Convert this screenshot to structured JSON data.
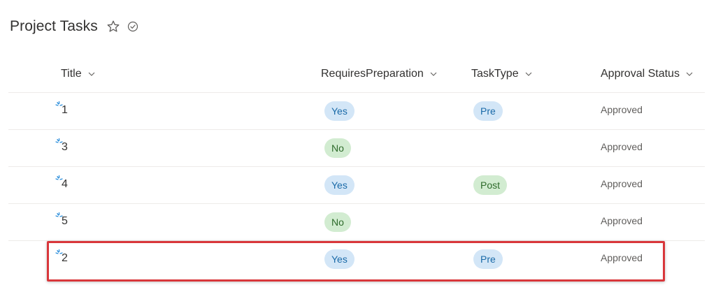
{
  "list": {
    "title": "Project Tasks"
  },
  "columns": {
    "title": "Title",
    "requires_preparation": "RequiresPreparation",
    "task_type": "TaskType",
    "approval_status": "Approval Status"
  },
  "rows": [
    {
      "title": "1",
      "requires_preparation": "Yes",
      "task_type": "Pre",
      "approval_status": "Approved"
    },
    {
      "title": "3",
      "requires_preparation": "No",
      "task_type": "",
      "approval_status": "Approved"
    },
    {
      "title": "4",
      "requires_preparation": "Yes",
      "task_type": "Post",
      "approval_status": "Approved"
    },
    {
      "title": "5",
      "requires_preparation": "No",
      "task_type": "",
      "approval_status": "Approved"
    },
    {
      "title": "2",
      "requires_preparation": "Yes",
      "task_type": "Pre",
      "approval_status": "Approved"
    }
  ],
  "highlighted_row_index": 4,
  "colors": {
    "yes_pill_bg": "#d3e6f7",
    "no_pill_bg": "#d2ecd1",
    "highlight_border": "#d9373b",
    "new_item_icon": "#0078d4"
  }
}
